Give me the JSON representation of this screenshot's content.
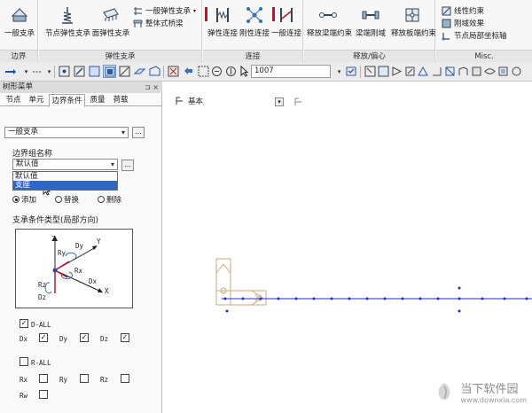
{
  "ribbon": {
    "groups": [
      {
        "label": "边界",
        "buttons": [
          "一般支承"
        ]
      },
      {
        "label": "弹性支承",
        "buttons": [
          "节点弹性支承",
          "面弹性支承",
          "一般弹性支承",
          "整体式桥梁"
        ]
      },
      {
        "label": "连接",
        "buttons": [
          "弹性连接",
          "刚性连接",
          "一般连接"
        ]
      },
      {
        "label": "释放/偏心",
        "buttons": [
          "释放梁端约束",
          "梁端刚域",
          "释放板端约束"
        ]
      },
      {
        "label": "Misc.",
        "buttons": [
          "线性约束",
          "刚域效果",
          "节点局部坐标轴"
        ]
      }
    ],
    "accent_color": "#c8102e"
  },
  "toolbar": {
    "input_value": "1007"
  },
  "panel": {
    "title": "树形菜单",
    "pins": "⊐ ×",
    "tabs": [
      "节点",
      "单元",
      "边界条件",
      "质量",
      "荷载"
    ],
    "active_tab": "边界条件",
    "type_select": "一般支承",
    "dots": "...",
    "group_label": "边界组名称",
    "group_select": "默认值",
    "dropdown_options": [
      "默认值",
      "支座"
    ],
    "selected_option": "支座",
    "options": {
      "add": "添加",
      "replace": "替换",
      "delete": "删除"
    },
    "support_type_label": "支承条件类型(局部方向)",
    "fig_labels": {
      "z": "Z",
      "y": "Y",
      "x": "X",
      "ry": "Ry",
      "dy": "Dy",
      "rx": "Rx",
      "dx": "Dx",
      "rz": "Rz",
      "dz": "Dz"
    },
    "d_all": "D-ALL",
    "d_checks": [
      {
        "label": "Dx",
        "checked": true
      },
      {
        "label": "Dy",
        "checked": true
      },
      {
        "label": "Dz",
        "checked": true
      }
    ],
    "r_all": "R-ALL",
    "r_checks": [
      {
        "label": "Rx",
        "checked": false
      },
      {
        "label": "Ry",
        "checked": false
      },
      {
        "label": "Rz",
        "checked": false
      },
      {
        "label": "Rw",
        "checked": false
      }
    ]
  },
  "canvas": {
    "view_label": "基本"
  },
  "watermark": {
    "text": "当下软件园",
    "url": "www.downxia.com"
  }
}
